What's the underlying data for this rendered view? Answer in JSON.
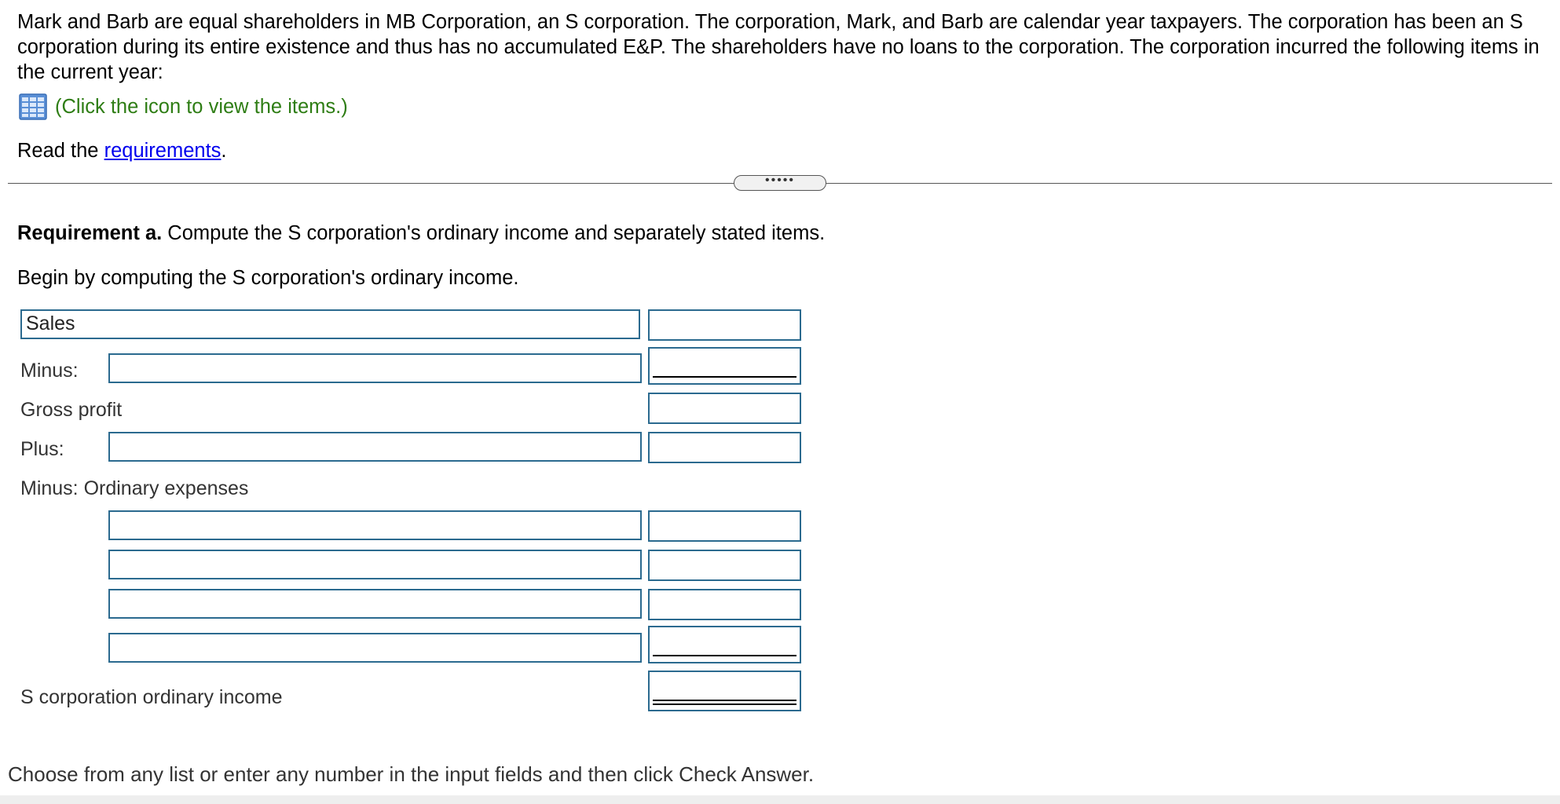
{
  "problem": {
    "text": "Mark and Barb are equal shareholders in MB Corporation, an S corporation. The corporation, Mark, and Barb are calendar year taxpayers. The corporation has been an S corporation during its entire existence and thus has no accumulated E&P. The shareholders have no loans to the corporation.  The corporation incurred the following items in the current year:",
    "items_link": "(Click the icon to view the items.)",
    "items_icon": "table-grid-icon",
    "read_prefix": "Read the ",
    "requirements_link": "requirements",
    "read_suffix": ".",
    "divider_handle": "•••••"
  },
  "requirement": {
    "title": "Requirement a.",
    "text": " Compute the S corporation's ordinary income and separately stated items.",
    "instruction": "Begin by computing the S corporation's ordinary income."
  },
  "form": {
    "sales_label": "Sales",
    "minus_label": "Minus:",
    "gross_profit_label": "Gross profit",
    "plus_label": "Plus:",
    "ordinary_expenses_label": "Minus: Ordinary expenses",
    "ordinary_income_label": "S corporation ordinary income"
  },
  "footer": {
    "text": "Choose from any list or enter any number in the input fields and then click Check Answer."
  },
  "colors": {
    "field_border": "#2b6a8f",
    "link_blue": "#0000ee",
    "hint_green": "#2e7d14"
  }
}
